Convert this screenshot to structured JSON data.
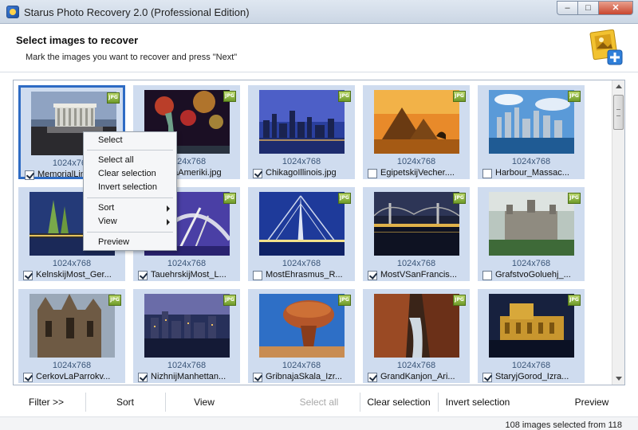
{
  "window": {
    "title": "Starus Photo Recovery 2.0 (Professional Edition)",
    "minimize_glyph": "–",
    "maximize_glyph": "□",
    "close_glyph": "✕"
  },
  "header": {
    "title": "Select images to recover",
    "subtitle": "Mark the images you want to recover and press \"Next\""
  },
  "badge_label": "JPG",
  "images": [
    {
      "dims": "1024x768",
      "filename": "MemorialLinkol...",
      "checked": true
    },
    {
      "dims": "1024x768",
      "filename": "StatujaAmeriki.jpg",
      "checked": true
    },
    {
      "dims": "1024x768",
      "filename": "ChikagoIllinois.jpg",
      "checked": true
    },
    {
      "dims": "1024x768",
      "filename": "EgipetskijVecher....",
      "checked": false
    },
    {
      "dims": "1024x768",
      "filename": "Harbour_Massac...",
      "checked": false
    },
    {
      "dims": "1024x768",
      "filename": "KelnskijMost_Ger...",
      "checked": true
    },
    {
      "dims": "1024x768",
      "filename": "TauehrskijMost_L...",
      "checked": true
    },
    {
      "dims": "1024x768",
      "filename": "MostEhrasmus_R...",
      "checked": false
    },
    {
      "dims": "1024x768",
      "filename": "MostVSanFrancis...",
      "checked": true
    },
    {
      "dims": "1024x768",
      "filename": "GrafstvoGoluehj_...",
      "checked": false
    },
    {
      "dims": "1024x768",
      "filename": "CerkovLaParrokv...",
      "checked": true
    },
    {
      "dims": "1024x768",
      "filename": "NizhnijManhettan...",
      "checked": true
    },
    {
      "dims": "1024x768",
      "filename": "GribnajaSkala_Izr...",
      "checked": true
    },
    {
      "dims": "1024x768",
      "filename": "GrandKanjon_Ari...",
      "checked": true
    },
    {
      "dims": "1024x768",
      "filename": "StaryjGorod_Izra...",
      "checked": true
    }
  ],
  "context_menu": {
    "select": "Select",
    "select_all": "Select all",
    "clear_selection": "Clear selection",
    "invert_selection": "Invert selection",
    "sort": "Sort",
    "view": "View",
    "preview": "Preview"
  },
  "toolbar": {
    "filter": "Filter >>",
    "sort": "Sort",
    "view": "View",
    "select_all": "Select all",
    "clear_selection": "Clear selection",
    "invert_selection": "Invert selection",
    "preview": "Preview"
  },
  "status": {
    "text": "108 images selected from 118"
  },
  "colors": {
    "tile_bg": "#cfdcef",
    "focus_border": "#2e6bc4",
    "badge_green": "#6f9b2a"
  }
}
